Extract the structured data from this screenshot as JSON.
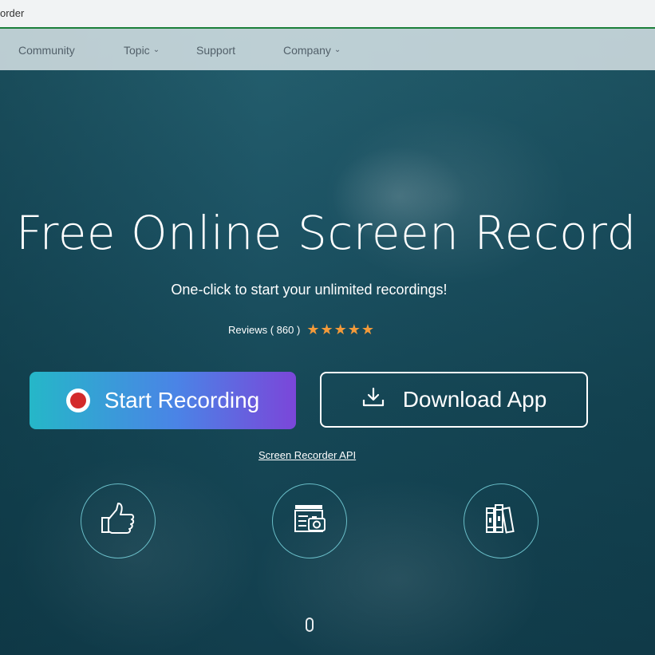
{
  "browser": {
    "tab_title": "order"
  },
  "nav": {
    "items": [
      {
        "label": "Community",
        "has_dropdown": false
      },
      {
        "label": "Topic",
        "has_dropdown": true
      },
      {
        "label": "Support",
        "has_dropdown": false
      },
      {
        "label": "Company",
        "has_dropdown": true
      }
    ]
  },
  "hero": {
    "title": "Free Online Screen Record",
    "subtitle": "One-click to start your unlimited recordings!",
    "reviews_label": "Reviews ( 860 )",
    "rating_stars": "★★★★★",
    "rating": 5,
    "start_button_label": "Start Recording",
    "download_button_label": "Download App",
    "api_link_label": "Screen Recorder API"
  },
  "features": [
    {
      "icon": "thumbs-up-icon"
    },
    {
      "icon": "media-files-icon"
    },
    {
      "icon": "book-library-icon"
    }
  ],
  "colors": {
    "accent_start_gradient_left": "#25b7c8",
    "accent_start_gradient_right": "#7b46d9",
    "star_color": "#f39a3a",
    "record_dot": "#d32a2a"
  }
}
